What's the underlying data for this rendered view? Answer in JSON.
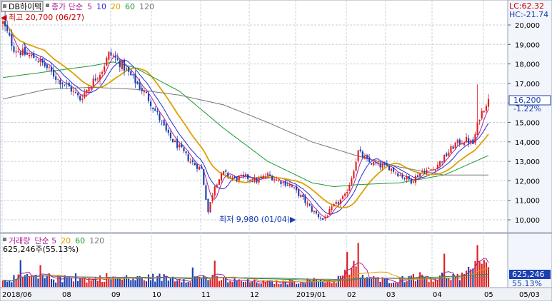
{
  "chart_data": {
    "type": "candlestick",
    "stock_name": "DB하이텍",
    "price_legend": {
      "items": [
        {
          "label": "종가 단순",
          "color": "#b0209a"
        },
        {
          "label": "5",
          "color": "#b0209a"
        },
        {
          "label": "10",
          "color": "#2a2ad0"
        },
        {
          "label": "20",
          "color": "#e0a000"
        },
        {
          "label": "60",
          "color": "#1a9a30"
        },
        {
          "label": "120",
          "color": "#777777"
        }
      ]
    },
    "high_annotation": "최고 20,700 (06/27)",
    "low_annotation": "최저 9,980 (01/04)",
    "lc_label": "LC:62.32",
    "hc_label": "HC:-21.74",
    "current_price_label": "16,200",
    "change_label": "-1.22%",
    "price_axis": {
      "min": 10000,
      "max": 20000,
      "ticks": [
        "20,000",
        "19,000",
        "18,000",
        "17,000",
        "16,000",
        "15,000",
        "14,000",
        "13,000",
        "12,000",
        "11,000",
        "10,000"
      ]
    },
    "volume_legend": {
      "items": [
        {
          "label": "거래량",
          "color": "#b0209a"
        },
        {
          "label": "단순 5",
          "color": "#b0209a"
        },
        {
          "label": "20",
          "color": "#e0a000"
        },
        {
          "label": "60",
          "color": "#1a9a30"
        },
        {
          "label": "120",
          "color": "#777777"
        }
      ]
    },
    "volume_text": "625,246주(55.13%)",
    "volume_current_label": "625,246",
    "volume_pct_label": "55.13%",
    "x_ticks": [
      "2018/06",
      "08",
      "09",
      "10",
      "11",
      "12",
      "2019/01",
      "02",
      "03",
      "04",
      "05",
      "05/03"
    ],
    "colors": {
      "up": "#e02020",
      "down": "#1a3fb0",
      "ma5": "#b0209a",
      "ma10": "#2a2ad0",
      "ma20": "#e0a000",
      "ma60": "#1a9a30",
      "ma120": "#777777"
    },
    "price_path": [
      [
        0,
        20100
      ],
      [
        5,
        18800
      ],
      [
        10,
        18500
      ],
      [
        15,
        18300
      ],
      [
        20,
        17800
      ],
      [
        25,
        17200
      ],
      [
        30,
        16800
      ],
      [
        35,
        16200
      ],
      [
        40,
        17000
      ],
      [
        45,
        17700
      ],
      [
        48,
        18500
      ],
      [
        50,
        18400
      ],
      [
        55,
        17800
      ],
      [
        60,
        17100
      ],
      [
        65,
        16400
      ],
      [
        70,
        15400
      ],
      [
        75,
        14300
      ],
      [
        80,
        13700
      ],
      [
        85,
        13000
      ],
      [
        90,
        12600
      ],
      [
        93,
        10400
      ],
      [
        96,
        11800
      ],
      [
        100,
        12400
      ],
      [
        105,
        12100
      ],
      [
        110,
        12200
      ],
      [
        115,
        12000
      ],
      [
        120,
        12300
      ],
      [
        125,
        12000
      ],
      [
        130,
        11800
      ],
      [
        135,
        11200
      ],
      [
        140,
        10500
      ],
      [
        145,
        10000
      ],
      [
        150,
        10700
      ],
      [
        155,
        11200
      ],
      [
        158,
        12200
      ],
      [
        161,
        13500
      ],
      [
        165,
        13000
      ],
      [
        170,
        12800
      ],
      [
        175,
        12700
      ],
      [
        180,
        12300
      ],
      [
        185,
        12000
      ],
      [
        190,
        12500
      ],
      [
        195,
        12600
      ],
      [
        200,
        13200
      ],
      [
        205,
        13900
      ],
      [
        210,
        14100
      ],
      [
        213,
        13900
      ],
      [
        216,
        15300
      ],
      [
        219,
        16000
      ],
      [
        220,
        16200
      ]
    ],
    "ma120_path": [
      [
        0,
        16200
      ],
      [
        20,
        16700
      ],
      [
        40,
        16800
      ],
      [
        60,
        16700
      ],
      [
        80,
        16400
      ],
      [
        100,
        15900
      ],
      [
        120,
        15000
      ],
      [
        140,
        14000
      ],
      [
        160,
        13300
      ],
      [
        180,
        12700
      ],
      [
        200,
        12300
      ],
      [
        220,
        12300
      ]
    ],
    "ma60_path": [
      [
        0,
        17300
      ],
      [
        20,
        17600
      ],
      [
        40,
        17900
      ],
      [
        50,
        18100
      ],
      [
        60,
        17800
      ],
      [
        80,
        16600
      ],
      [
        100,
        14700
      ],
      [
        120,
        13000
      ],
      [
        140,
        11900
      ],
      [
        150,
        11700
      ],
      [
        160,
        11800
      ],
      [
        180,
        11900
      ],
      [
        200,
        12300
      ],
      [
        220,
        13300
      ]
    ],
    "volume_path": [
      [
        0,
        300
      ],
      [
        8,
        280
      ],
      [
        12,
        360
      ],
      [
        16,
        260
      ],
      [
        20,
        320
      ],
      [
        25,
        240
      ],
      [
        30,
        300
      ],
      [
        40,
        240
      ],
      [
        47,
        330
      ],
      [
        55,
        240
      ],
      [
        62,
        280
      ],
      [
        70,
        320
      ],
      [
        80,
        280
      ],
      [
        86,
        270
      ],
      [
        90,
        340
      ],
      [
        100,
        230
      ],
      [
        110,
        180
      ],
      [
        120,
        160
      ],
      [
        130,
        150
      ],
      [
        137,
        200
      ],
      [
        145,
        220
      ],
      [
        150,
        190
      ],
      [
        155,
        420
      ],
      [
        159,
        620
      ],
      [
        165,
        290
      ],
      [
        172,
        230
      ],
      [
        178,
        210
      ],
      [
        185,
        330
      ],
      [
        190,
        350
      ],
      [
        195,
        270
      ],
      [
        200,
        380
      ],
      [
        207,
        320
      ],
      [
        213,
        420
      ],
      [
        216,
        1320
      ],
      [
        219,
        760
      ],
      [
        220,
        625
      ]
    ],
    "volume_max": 1400,
    "n_bars": 221
  }
}
